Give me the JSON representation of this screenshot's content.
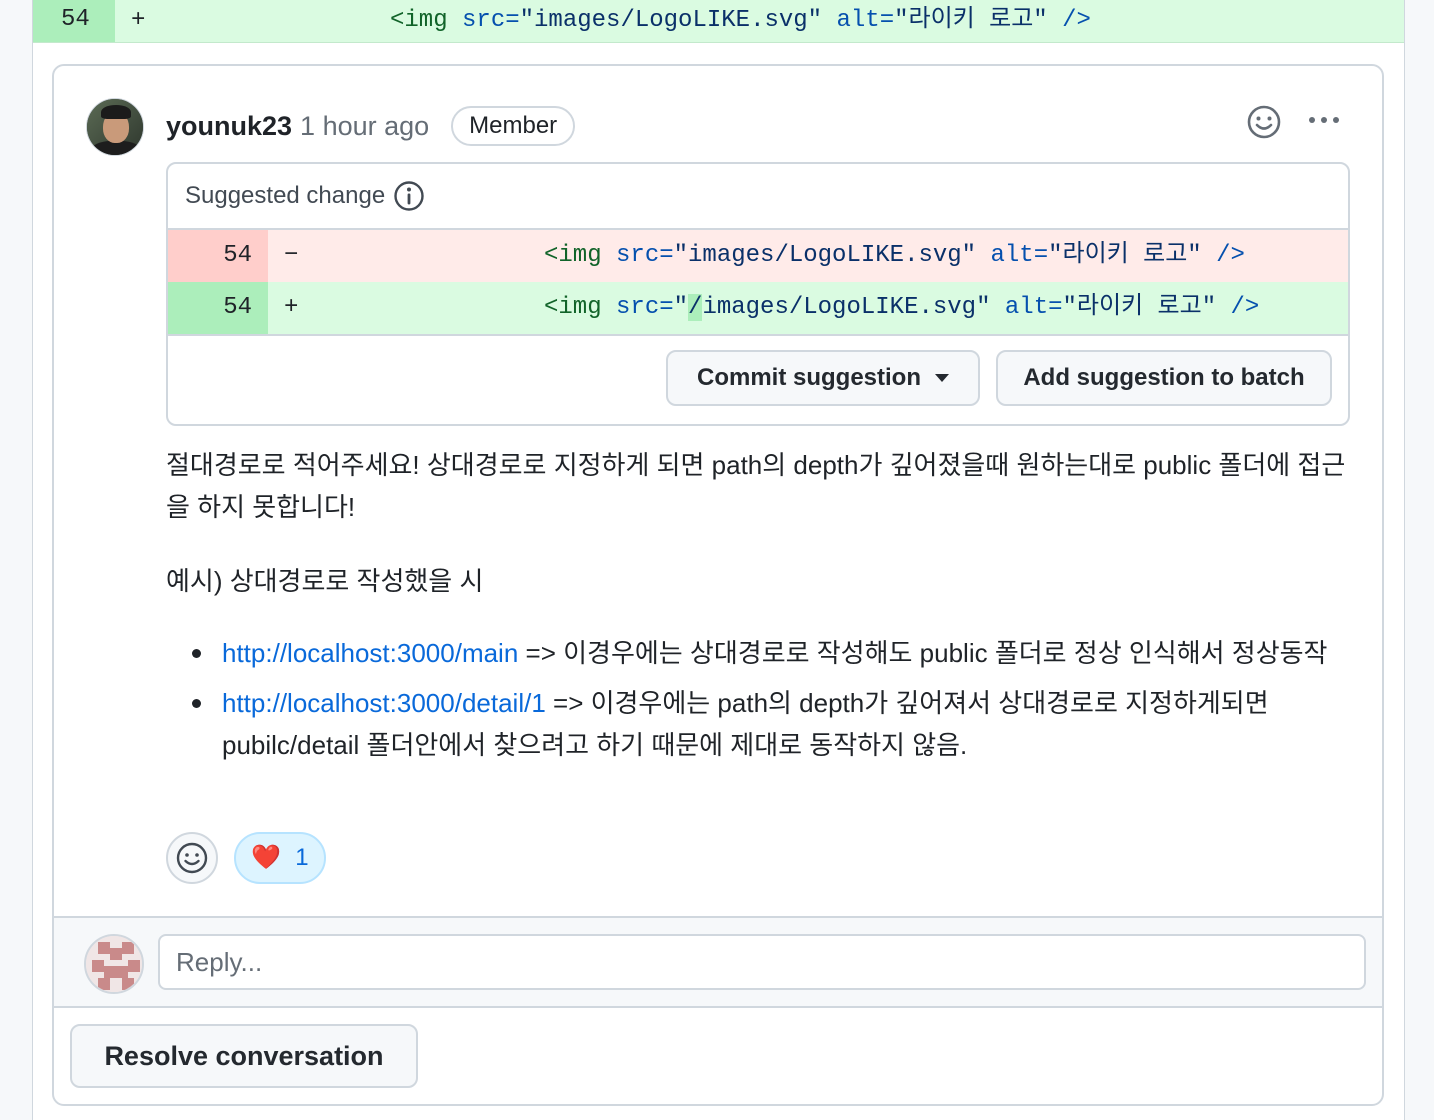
{
  "top_diff": {
    "line_number": "54",
    "sign": "+",
    "code_tag": "<img ",
    "code_attr1": "src=",
    "code_val1": "\"images/LogoLIKE.svg\"",
    "code_attr2": "alt=",
    "code_val2": "\"라이키 로고\"",
    "code_end": " />"
  },
  "comment": {
    "author": "younuk23",
    "time": "1 hour ago",
    "badge": "Member",
    "icons": [
      "smiley-icon",
      "kebab-menu-icon",
      "info-icon"
    ],
    "suggested_change": {
      "title": "Suggested change",
      "deleted": {
        "line_number": "54",
        "sign": "−",
        "code_tag": "<img ",
        "code_attr1": "src=",
        "code_val1": "\"images/LogoLIKE.svg\"",
        "code_attr2": "alt=",
        "code_val2": "\"라이키 로고\"",
        "code_end": " />"
      },
      "added": {
        "line_number": "54",
        "sign": "+",
        "code_tag": "<img ",
        "code_attr1": "src=",
        "code_val1_pre": "\"",
        "code_val1_hl": "/",
        "code_val1_post": "images/LogoLIKE.svg\"",
        "code_attr2": "alt=",
        "code_val2": "\"라이키 로고\"",
        "code_end": " />"
      },
      "commit_label": "Commit suggestion",
      "batch_label": "Add suggestion to batch"
    },
    "body": {
      "paragraph1": "절대경로로 적어주세요! 상대경로로 지정하게 되면 path의 depth가 깊어졌을때 원하는대로 public 폴더에 접근을 하지 못합니다!",
      "paragraph2": "예시) 상대경로로 작성했을 시",
      "items": [
        {
          "link": "http://localhost:3000/main",
          "text": " => 이경우에는 상대경로로 작성해도 public 폴더로 정상 인식해서 정상동작"
        },
        {
          "link": "http://localhost:3000/detail/1",
          "text": " => 이경우에는 path의 depth가 깊어져서 상대경로로 지정하게되면 pubilc/detail 폴더안에서 찾으려고 하기 때문에 제대로 동작하지 않음."
        }
      ]
    },
    "reactions": {
      "heart_emoji": "❤️",
      "heart_count": "1"
    }
  },
  "reply": {
    "placeholder": "Reply..."
  },
  "resolve_label": "Resolve conversation",
  "colors": {
    "diff_add_bg": "#dafbe1",
    "diff_del_bg": "#ffebe9",
    "link": "#0969da",
    "border": "#d0d7de"
  }
}
